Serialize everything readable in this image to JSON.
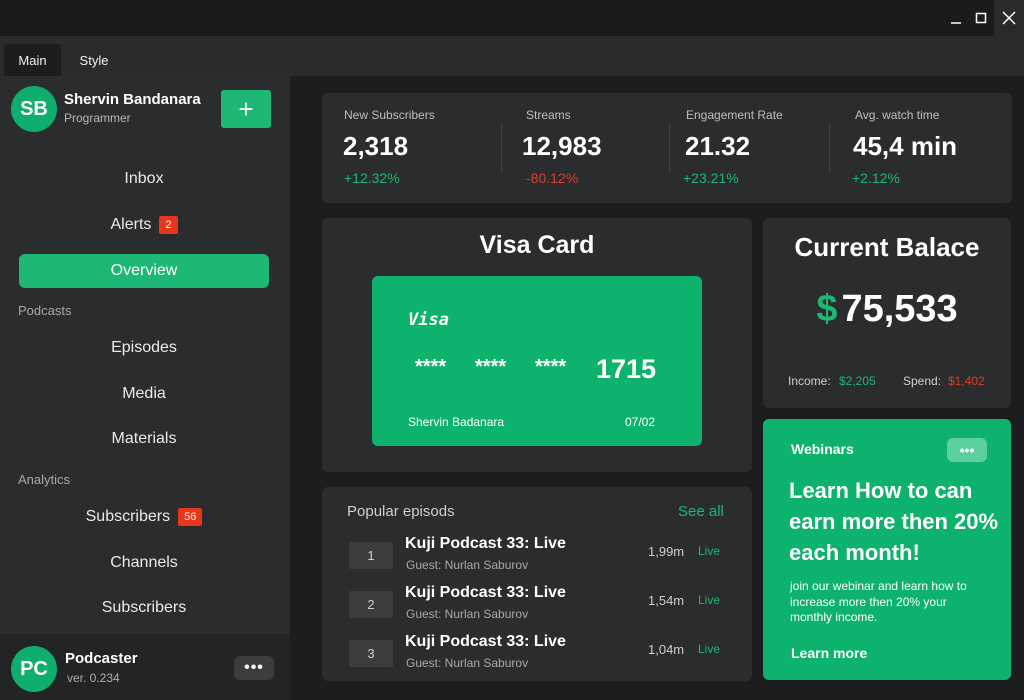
{
  "window": {
    "minimize": "_",
    "maximize": "□",
    "close": "✕"
  },
  "tabs": [
    {
      "label": "Main"
    },
    {
      "label": "Style"
    }
  ],
  "profile": {
    "initials": "SB",
    "name": "Shervin Bandanara",
    "role": "Programmer",
    "add_label": "+"
  },
  "nav": {
    "inbox": "Inbox",
    "alerts": "Alerts",
    "alerts_badge": "2",
    "overview": "Overview",
    "podcasts_section": "Podcasts",
    "episodes": "Episodes",
    "media": "Media",
    "materials": "Materials",
    "analytics_section": "Analytics",
    "subscribers": "Subscribers",
    "subscribers_badge": "56",
    "channels": "Channels",
    "subscribers2": "Subscribers"
  },
  "footer": {
    "initials": "PC",
    "name": "Podcaster",
    "version": "ver. 0.234",
    "menu": "•••"
  },
  "stats": [
    {
      "label": "New Subscribers",
      "value": "2,318",
      "change": "+12.32%",
      "trend": "up"
    },
    {
      "label": "Streams",
      "value": "12,983",
      "change": "-80.12%",
      "trend": "down"
    },
    {
      "label": "Engagement Rate",
      "value": "21.32",
      "change": "+23.21%",
      "trend": "up"
    },
    {
      "label": "Avg. watch time",
      "value": "45,4 min",
      "change": "+2.12%",
      "trend": "up"
    }
  ],
  "visa": {
    "title": "Visa Card",
    "brand": "Visa",
    "masked": [
      "****",
      "****",
      "****"
    ],
    "last4": "1715",
    "holder": "Shervin Badanara",
    "expiry": "07/02"
  },
  "balance": {
    "title": "Current Balace",
    "currency": "$",
    "amount": "75,533",
    "income_label": "Income:",
    "income": "$2,205",
    "spend_label": "Spend:",
    "spend": "$1,402"
  },
  "webinar": {
    "title": "Webinars",
    "menu": "•••",
    "headline": "Learn How to can earn more then 20% each month!",
    "body": "join our webinar and learn how to increase more then 20% your monthly income.",
    "cta": "Learn more"
  },
  "popular": {
    "title": "Popular episods",
    "see_all": "See all",
    "episodes": [
      {
        "num": "1",
        "title": "Kuji Podcast 33: Live",
        "guest": "Guest: Nurlan Saburov",
        "duration": "1,99m",
        "status": "Live"
      },
      {
        "num": "2",
        "title": "Kuji Podcast 33: Live",
        "guest": "Guest: Nurlan Saburov",
        "duration": "1,54m",
        "status": "Live"
      },
      {
        "num": "3",
        "title": "Kuji Podcast 33: Live",
        "guest": "Guest: Nurlan Saburov",
        "duration": "1,04m",
        "status": "Live"
      }
    ]
  },
  "colors": {
    "accent": "#1db873",
    "card": "#0db26c",
    "up": "#1db873",
    "down": "#d2412d",
    "badge": "#e8361b",
    "background": "#1b1d1f",
    "panel": "#2a2c2e"
  }
}
